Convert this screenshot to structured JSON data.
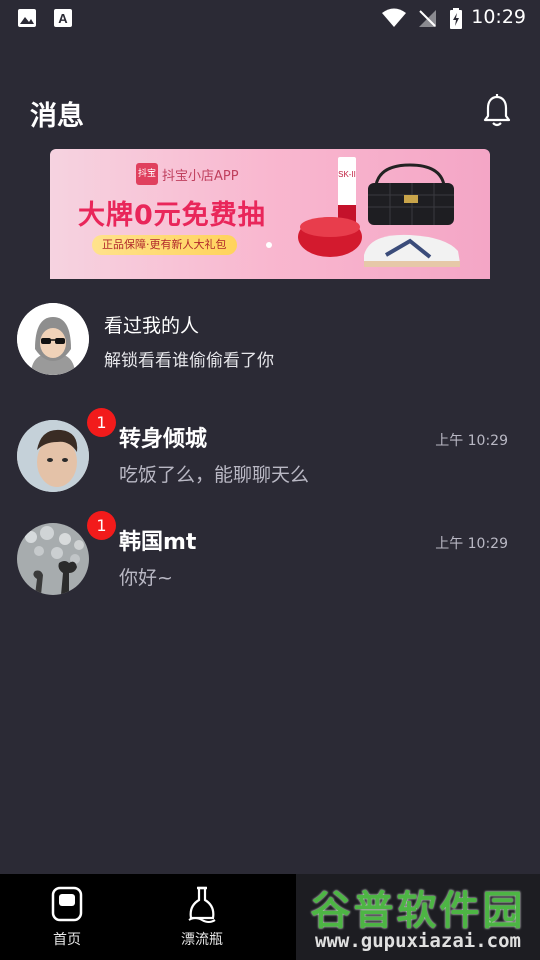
{
  "status_bar": {
    "time": "10:29"
  },
  "header": {
    "title": "消息"
  },
  "banner": {
    "shop_name": "抖宝小店APP",
    "logo_text": "抖宝",
    "headline": "大牌0元免费抽",
    "tagline": "正品保障·更有新人大礼包",
    "product_label": "SK-II"
  },
  "visitors": {
    "title": "看过我的人",
    "subtitle": "解锁看看谁偷偷看了你"
  },
  "conversations": [
    {
      "name": "转身倾城",
      "message": "吃饭了么，能聊聊天么",
      "time": "上午 10:29",
      "unread": "1"
    },
    {
      "name": "韩国mt",
      "message": "你好~",
      "time": "上午 10:29",
      "unread": "1"
    }
  ],
  "tabs": [
    {
      "label": "首页"
    },
    {
      "label": "漂流瓶"
    }
  ],
  "watermark": {
    "name": "谷普软件园",
    "url": "www.gupuxiazai.com"
  }
}
